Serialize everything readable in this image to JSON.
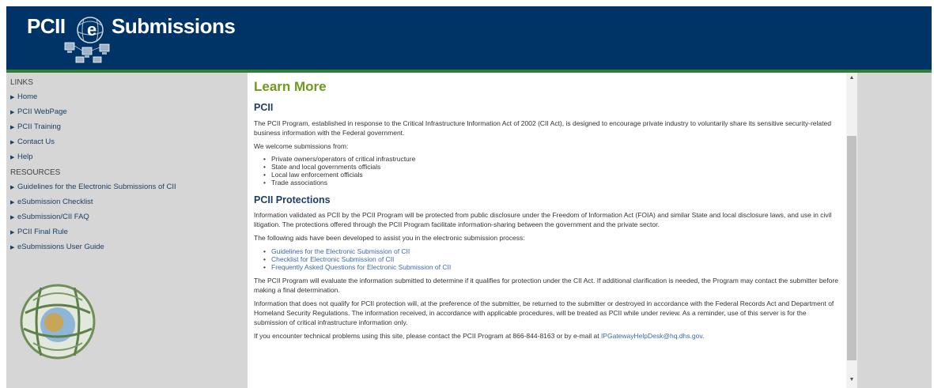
{
  "header": {
    "logo_pcii": "PCII",
    "logo_sub": "Submissions",
    "logo_e": "e"
  },
  "sidebar": {
    "links_title": "LINKS",
    "links": [
      "Home",
      "PCII WebPage",
      "PCII Training",
      "Contact Us",
      "Help"
    ],
    "resources_title": "RESOURCES",
    "resources": [
      "Guidelines for the Electronic Submissions of CII",
      "eSubmission Checklist",
      "eSubmission/CII FAQ",
      "PCII Final Rule",
      "eSubmissions User Guide"
    ]
  },
  "main": {
    "title": "Learn More",
    "pcii_heading": "PCII",
    "pcii_p1": "The PCII Program, established in response to the Critical Infrastructure Information Act of 2002 (CII Act), is designed to encourage private industry to voluntarily share its sensitive security-related business information with the Federal government.",
    "pcii_p2": "We welcome submissions from:",
    "welcome_list": [
      "Private owners/operators of critical infrastructure",
      "State and local governments officials",
      "Local law enforcement officials",
      "Trade associations"
    ],
    "protections_heading": "PCII Protections",
    "prot_p1": "Information validated as PCII by the PCII Program will be protected from public disclosure under the Freedom of Information Act (FOIA) and similar State and local disclosure laws, and use in civil litigation. The protections offered through the PCII Program facilitate information-sharing between the government and the private sector.",
    "prot_p2": "The following aids have been developed to assist you in the electronic submission process:",
    "aids_list": [
      "Guidelines for the Electronic Submission of CII",
      "Checklist for Electronic Submission of CII",
      "Frequently Asked Questions for Electronic Submission of CII"
    ],
    "prot_p3": "The PCII Program will evaluate the information submitted to determine if it qualifies for protection under the CII Act. If additional clarification is needed, the Program may contact the submitter before making a final determination.",
    "prot_p4": "Information that does not qualify for PCII protection will, at the preference of the submitter, be returned to the submitter or destroyed in accordance with the Federal Records Act and Department of Homeland Security Regulations. The information received, in accordance with applicable procedures, will be treated as PCII while under review. As a reminder, use of this server is for the submission of critical infrastructure information only.",
    "contact_text": "If you encounter technical problems using this site, please contact the PCII Program at 866-844-8163 or by e-mail at ",
    "contact_email": "IPGatewayHelpDesk@hq.dhs.gov",
    "contact_end": "."
  },
  "colors": {
    "header_bg": "#003466",
    "header_line": "#2f7d2f",
    "title_green": "#6d9a1f",
    "heading_blue": "#1e3e66",
    "link_blue": "#3a6aa8",
    "sidebar_bg": "#d6d6d6"
  }
}
